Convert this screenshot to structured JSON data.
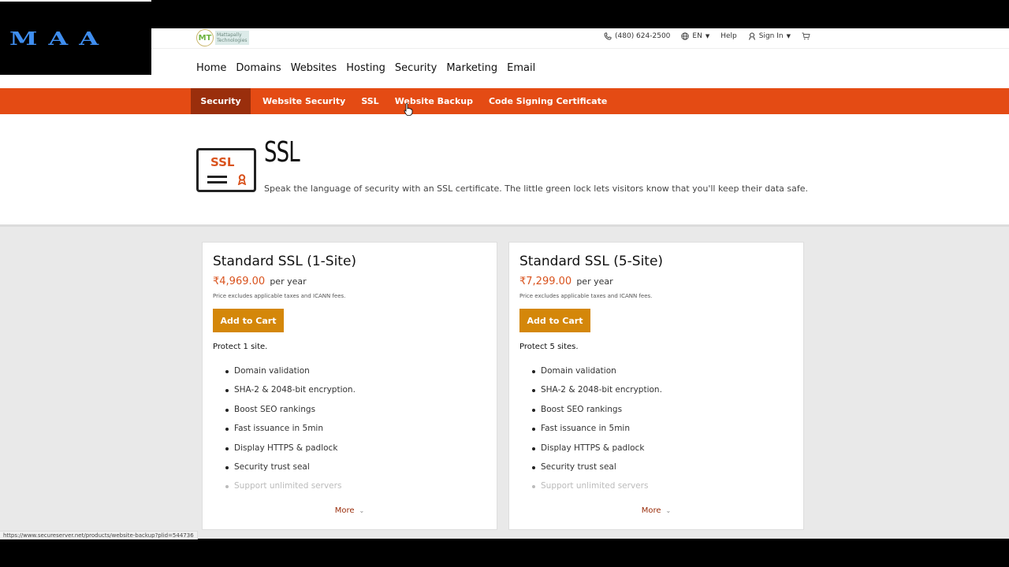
{
  "watermark": {
    "text": "MAA",
    "color": "#3f8ef0"
  },
  "brand": {
    "logo_mark": "MT",
    "logo_text_line1": "Mattapally",
    "logo_text_line2": "Technologies"
  },
  "utility": {
    "phone": "(480) 624-2500",
    "language": "EN",
    "help": "Help",
    "sign_in": "Sign In",
    "icons": [
      "phone-icon",
      "globe-icon",
      "user-icon",
      "cart-icon"
    ]
  },
  "main_nav": [
    {
      "label": "Home"
    },
    {
      "label": "Domains"
    },
    {
      "label": "Websites"
    },
    {
      "label": "Hosting"
    },
    {
      "label": "Security"
    },
    {
      "label": "Marketing"
    },
    {
      "label": "Email"
    }
  ],
  "sub_nav": {
    "section": "Security",
    "items": [
      {
        "label": "Website Security"
      },
      {
        "label": "SSL",
        "active": true
      },
      {
        "label": "Website Backup"
      },
      {
        "label": "Code Signing Certificate"
      }
    ]
  },
  "hero": {
    "icon_text": "SSL",
    "title": "SSL",
    "subtitle": "Speak the language of security with an SSL certificate. The little green lock lets visitors know that you'll keep their data safe."
  },
  "products": [
    {
      "title": "Standard SSL (1-Site)",
      "price": "₹4,969.00",
      "period": "per year",
      "note": "Price excludes applicable taxes and ICANN fees.",
      "button": "Add to Cart",
      "protect": "Protect 1 site.",
      "features": [
        "Domain validation",
        "SHA-2 & 2048-bit encryption.",
        "Boost SEO rankings",
        "Fast issuance in 5min",
        "Display HTTPS & padlock",
        "Security trust seal",
        "Support unlimited servers"
      ],
      "more": "More"
    },
    {
      "title": "Standard SSL (5-Site)",
      "price": "₹7,299.00",
      "period": "per year",
      "note": "Price excludes applicable taxes and ICANN fees.",
      "button": "Add to Cart",
      "protect": "Protect 5 sites.",
      "features": [
        "Domain validation",
        "SHA-2 & 2048-bit encryption.",
        "Boost SEO rankings",
        "Fast issuance in 5min",
        "Display HTTPS & padlock",
        "Security trust seal",
        "Support unlimited servers"
      ],
      "more": "More"
    }
  ],
  "status_bar": {
    "url": "https://www.secureserver.net/products/website-backup?plid=544736"
  },
  "colors": {
    "accent_orange": "#e44b14",
    "dark_orange": "#9a2e0c",
    "button": "#d4870a",
    "price": "#d9531e"
  }
}
